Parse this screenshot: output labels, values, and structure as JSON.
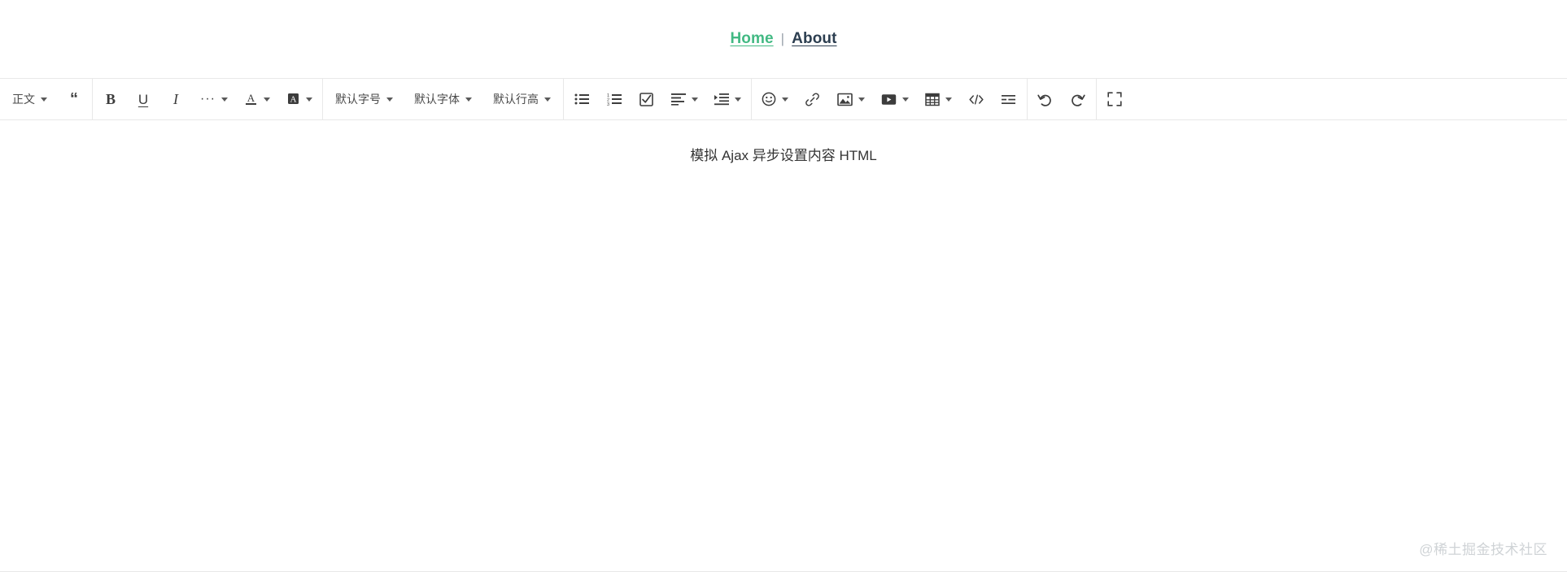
{
  "nav": {
    "home": "Home",
    "separator": "|",
    "about": "About",
    "home_color": "#42b983",
    "about_color": "#2c3e50"
  },
  "toolbar": {
    "groups": [
      {
        "name": "paragraph",
        "items": [
          {
            "name": "paragraph-style",
            "label": "正文",
            "icon": "paragraph-style-text",
            "has_caret": true
          },
          {
            "name": "blockquote",
            "label": "",
            "icon": "blockquote-icon",
            "has_caret": false
          }
        ]
      },
      {
        "name": "text-format",
        "items": [
          {
            "name": "bold",
            "label": "B",
            "icon": "bold-icon",
            "has_caret": false
          },
          {
            "name": "underline",
            "label": "U",
            "icon": "underline-icon",
            "has_caret": false
          },
          {
            "name": "italic",
            "label": "I",
            "icon": "italic-icon",
            "has_caret": false
          },
          {
            "name": "more-text-styles",
            "label": "",
            "icon": "ellipsis-icon",
            "has_caret": true
          },
          {
            "name": "font-color",
            "label": "A",
            "icon": "font-color-icon",
            "has_caret": true
          },
          {
            "name": "background-color",
            "label": "A",
            "icon": "background-color-icon",
            "has_caret": true
          }
        ]
      },
      {
        "name": "font-settings",
        "items": [
          {
            "name": "font-size",
            "label": "默认字号",
            "icon": "font-size-text",
            "has_caret": true
          },
          {
            "name": "font-family",
            "label": "默认字体",
            "icon": "font-family-text",
            "has_caret": true
          },
          {
            "name": "line-height",
            "label": "默认行高",
            "icon": "line-height-text",
            "has_caret": true
          }
        ]
      },
      {
        "name": "lists-alignment",
        "items": [
          {
            "name": "bulleted-list",
            "label": "",
            "icon": "bulleted-list-icon",
            "has_caret": false
          },
          {
            "name": "numbered-list",
            "label": "",
            "icon": "numbered-list-icon",
            "has_caret": false
          },
          {
            "name": "todo-list",
            "label": "",
            "icon": "checkbox-icon",
            "has_caret": false
          },
          {
            "name": "text-align",
            "label": "",
            "icon": "align-left-icon",
            "has_caret": true
          },
          {
            "name": "indent",
            "label": "",
            "icon": "indent-icon",
            "has_caret": true
          }
        ]
      },
      {
        "name": "insert-media",
        "items": [
          {
            "name": "emoji",
            "label": "",
            "icon": "emoji-icon",
            "has_caret": true
          },
          {
            "name": "link",
            "label": "",
            "icon": "link-icon",
            "has_caret": false
          },
          {
            "name": "image",
            "label": "",
            "icon": "image-icon",
            "has_caret": true
          },
          {
            "name": "video",
            "label": "",
            "icon": "video-icon",
            "has_caret": true
          },
          {
            "name": "table",
            "label": "",
            "icon": "table-icon",
            "has_caret": true
          },
          {
            "name": "code-block",
            "label": "",
            "icon": "code-icon",
            "has_caret": false
          },
          {
            "name": "horizontal-rule",
            "label": "",
            "icon": "horizontal-rule-icon",
            "has_caret": false
          }
        ]
      },
      {
        "name": "history",
        "items": [
          {
            "name": "undo",
            "label": "",
            "icon": "undo-icon",
            "has_caret": false
          },
          {
            "name": "redo",
            "label": "",
            "icon": "redo-icon",
            "has_caret": false
          }
        ]
      },
      {
        "name": "view",
        "items": [
          {
            "name": "fullscreen",
            "label": "",
            "icon": "fullscreen-icon",
            "has_caret": false
          }
        ]
      }
    ]
  },
  "editor": {
    "content": "模拟 Ajax 异步设置内容 HTML"
  },
  "watermark": {
    "text": "@稀土掘金技术社区"
  }
}
